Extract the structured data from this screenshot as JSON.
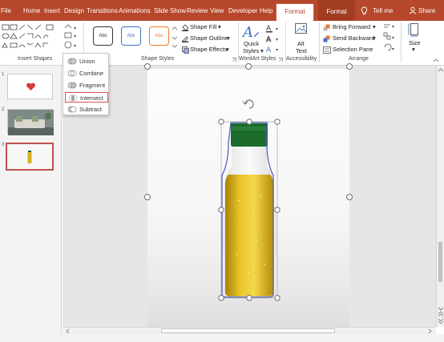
{
  "tabs": [
    "File",
    "Home",
    "Insert",
    "Design",
    "Transitions",
    "Animations",
    "Slide Show",
    "Review",
    "View",
    "Developer",
    "Help"
  ],
  "format_tab": "Format",
  "format_tab_2": "Format",
  "tell_me": "Tell me",
  "share": "Share",
  "ribbon": {
    "insert_shapes_label": "Insert Shapes",
    "shape_styles_label": "Shape Styles",
    "wordart_label": "WordArt Styles",
    "accessibility_label": "Accessibility",
    "arrange_label": "Arrange",
    "swatch_text": "Abc",
    "shape_fill": "Shape Fill",
    "shape_outline": "Shape Outline",
    "shape_effects": "Shape Effects",
    "quick_styles_1": "Quick",
    "quick_styles_2": "Styles",
    "alt_text_1": "Alt",
    "alt_text_2": "Text",
    "bring_forward": "Bring Forward",
    "send_backward": "Send Backward",
    "selection_pane": "Selection Pane",
    "size": "Size",
    "swatch_colors": [
      "#333333",
      "#4472c4",
      "#ed7d31"
    ]
  },
  "merge_menu": {
    "items": [
      "Union",
      "Combine",
      "Fragment",
      "Intersect",
      "Subtract"
    ],
    "highlighted": "Intersect"
  },
  "slides": [
    "1",
    "2",
    "3"
  ],
  "colors": {
    "accent": "#b7472a",
    "bottle_cap": "#1e6b2e",
    "oil": "#d9b21a",
    "selection_outline": "#4a5cb8"
  }
}
